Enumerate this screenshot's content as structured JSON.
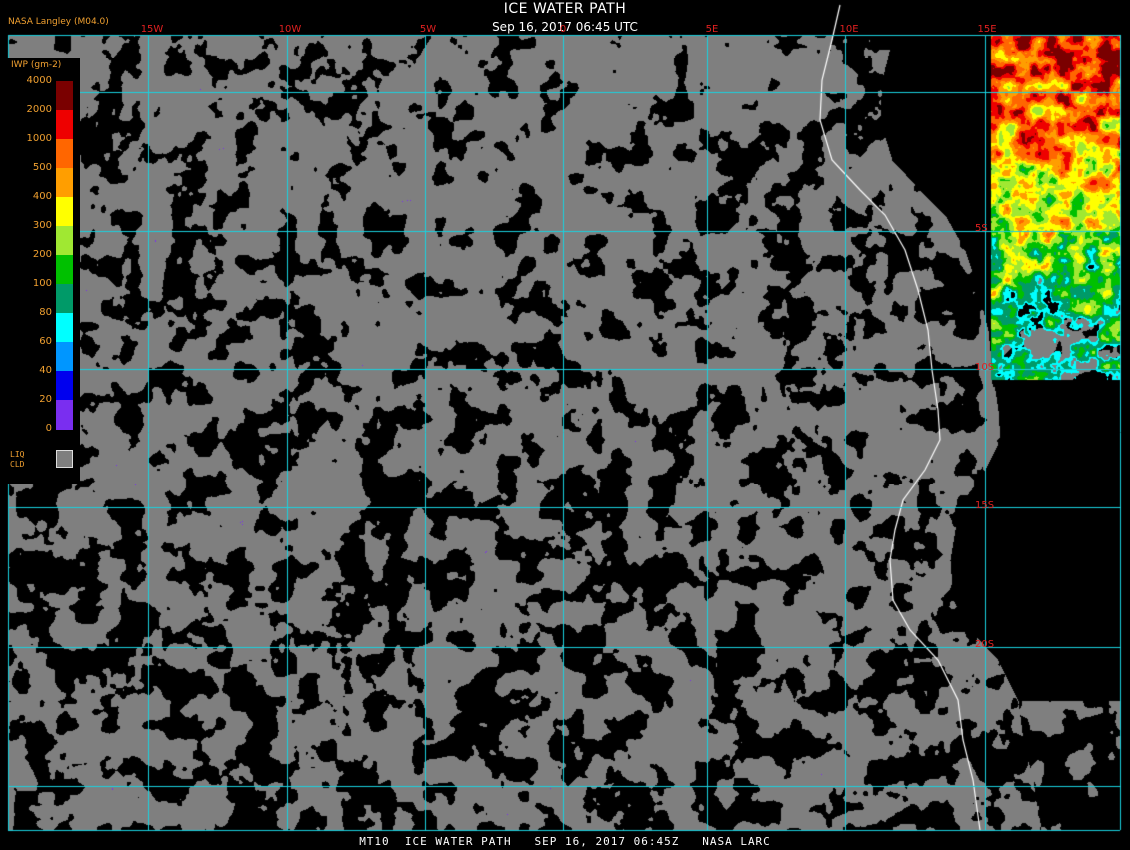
{
  "header": {
    "title": "ICE WATER PATH",
    "subtitle": "Sep 16, 2017 06:45 UTC",
    "producer": "NASA Langley (M04.0)"
  },
  "footer": "MT10  ICE WATER PATH   SEP 16, 2017 06:45Z   NASA LARC",
  "graticule": {
    "longitudes": [
      "15W",
      "10W",
      "5W",
      "0",
      "5E",
      "10E",
      "15E"
    ],
    "latitudes": [
      "5S",
      "10S",
      "15S",
      "20S"
    ],
    "line_color": "#19d2df"
  },
  "legend": {
    "units": "IWP (gm-2)",
    "ticks": [
      "4000",
      "2000",
      "1000",
      "500",
      "400",
      "300",
      "200",
      "100",
      "80",
      "60",
      "40",
      "20",
      "0"
    ],
    "colors": [
      "#7a0000",
      "#ee0000",
      "#ff6600",
      "#ff9e00",
      "#ffff00",
      "#a0e832",
      "#00c000",
      "#009a68",
      "#00ffff",
      "#0096ff",
      "#0000ee",
      "#7a2ef0"
    ],
    "liquid_label_1": "LIQ",
    "liquid_label_2": "CLD",
    "liquid_color": "#7f7f7f"
  },
  "colors": {
    "background": "#000000",
    "liquid_cloud": "#7f7f7f",
    "coastline": "#ffffff",
    "label_red": "#e02020",
    "label_orange": "#f0a030"
  }
}
